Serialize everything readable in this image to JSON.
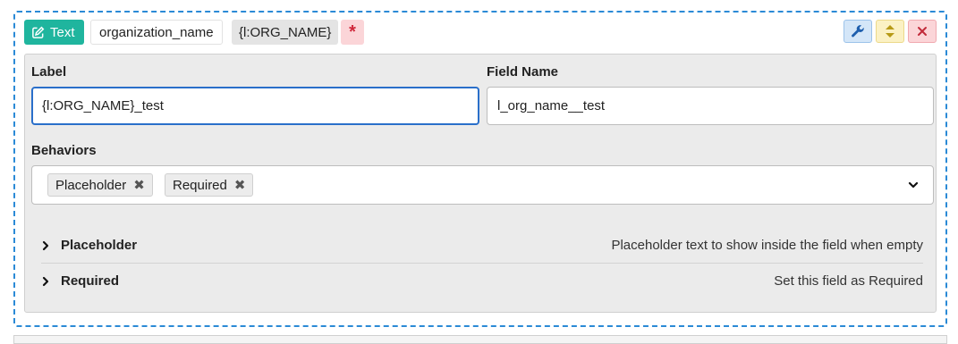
{
  "field": {
    "type_label": "Text",
    "name": "organization_name",
    "label_chip": "{l:ORG_NAME}",
    "required_marker": "*"
  },
  "form": {
    "label_title": "Label",
    "label_value": "{l:ORG_NAME}_test",
    "field_name_title": "Field Name",
    "field_name_value": "l_org_name__test",
    "behaviors_title": "Behaviors",
    "behaviors": [
      {
        "label": "Placeholder",
        "remove": "✖"
      },
      {
        "label": "Required",
        "remove": "✖"
      }
    ]
  },
  "accordion": [
    {
      "title": "Placeholder",
      "description": "Placeholder text to show inside the field when empty"
    },
    {
      "title": "Required",
      "description": "Set this field as Required"
    }
  ],
  "colors": {
    "card_border": "#2b8ad6",
    "type_badge": "#1fb59e",
    "required": "#d0263a",
    "focus": "#2a6fca"
  },
  "icons": {
    "type_badge": "edit-icon",
    "wrench": "wrench-icon",
    "move": "sort-arrows-icon",
    "close": "close-icon",
    "dropdown": "chevron-down-icon",
    "accordion": "chevron-right-icon"
  }
}
